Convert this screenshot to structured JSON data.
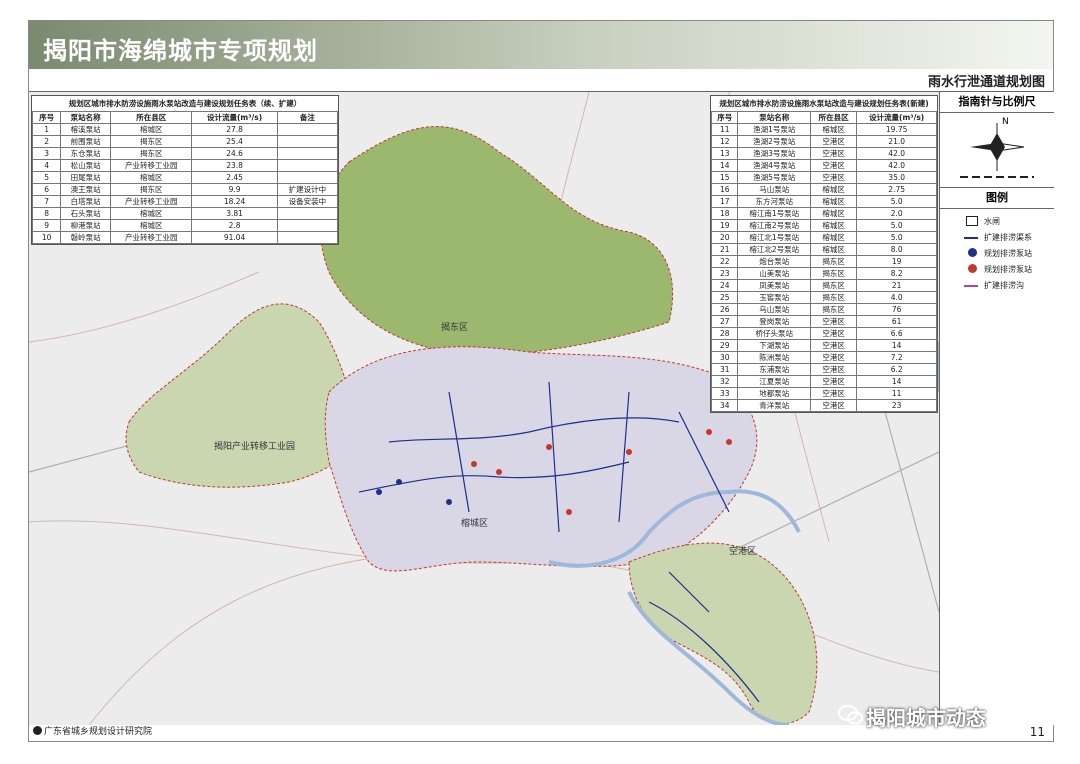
{
  "header": {
    "title": "揭阳市海绵城市专项规划",
    "subtitle": "雨水行泄通道规划图"
  },
  "sidebar": {
    "compass_title": "指南针与比例尺",
    "compass_north": "N",
    "legend_title": "图例",
    "legend": [
      {
        "label": "水闸",
        "icon": "sluice-icon"
      },
      {
        "label": "扩建排涝渠系",
        "icon": "drainage-line-icon"
      },
      {
        "label": "规划排涝泵站",
        "icon": "planned-pump-icon"
      },
      {
        "label": "规划排涝泵站",
        "icon": "planned-pump-red-icon"
      },
      {
        "label": "扩建排涝沟",
        "icon": "ditch-line-icon"
      }
    ]
  },
  "table_left": {
    "caption": "规划区城市排水防涝设施雨水泵站改造与建设规划任务表（续、扩建）",
    "headers": [
      "序号",
      "泵站名称",
      "所在县区",
      "设计流量(m³/s)",
      "备注"
    ],
    "rows": [
      [
        "1",
        "榕溪泵站",
        "榕城区",
        "27.8",
        ""
      ],
      [
        "2",
        "前围泵站",
        "揭东区",
        "25.4",
        ""
      ],
      [
        "3",
        "东仓泵站",
        "揭东区",
        "24.6",
        ""
      ],
      [
        "4",
        "松山泵站",
        "产业转移工业园",
        "23.8",
        ""
      ],
      [
        "5",
        "田尾泵站",
        "榕城区",
        "2.45",
        ""
      ],
      [
        "6",
        "澳王泵站",
        "揭东区",
        "9.9",
        "扩建设计中"
      ],
      [
        "7",
        "白塔泵站",
        "产业转移工业园",
        "18.24",
        "设备安装中"
      ],
      [
        "8",
        "石头泵站",
        "榕城区",
        "3.81",
        ""
      ],
      [
        "9",
        "柳港泵站",
        "榕城区",
        "2.8",
        ""
      ],
      [
        "10",
        "磐岭泵站",
        "产业转移工业园",
        "91.04",
        ""
      ]
    ]
  },
  "table_right": {
    "caption": "规划区城市排水防涝设施雨水泵站改造与建设规划任务表(新建)",
    "headers": [
      "序号",
      "泵站名称",
      "所在县区",
      "设计流量(m³/s)"
    ],
    "rows": [
      [
        "11",
        "渔湖1号泵站",
        "榕城区",
        "19.75"
      ],
      [
        "12",
        "渔湖2号泵站",
        "空港区",
        "21.0"
      ],
      [
        "13",
        "渔湖3号泵站",
        "空港区",
        "42.0"
      ],
      [
        "14",
        "渔湖4号泵站",
        "空港区",
        "42.0"
      ],
      [
        "15",
        "渔湖5号泵站",
        "空港区",
        "35.0"
      ],
      [
        "16",
        "马山泵站",
        "榕城区",
        "2.75"
      ],
      [
        "17",
        "东方河泵站",
        "榕城区",
        "5.0"
      ],
      [
        "18",
        "榕江南1号泵站",
        "榕城区",
        "2.0"
      ],
      [
        "19",
        "榕江南2号泵站",
        "榕城区",
        "5.0"
      ],
      [
        "20",
        "榕江北1号泵站",
        "榕城区",
        "5.0"
      ],
      [
        "21",
        "榕江北2号泵站",
        "榕城区",
        "8.0"
      ],
      [
        "22",
        "炮台泵站",
        "揭东区",
        "19"
      ],
      [
        "23",
        "山美泵站",
        "揭东区",
        "8.2"
      ],
      [
        "24",
        "凤美泵站",
        "揭东区",
        "21"
      ],
      [
        "25",
        "玉窖泵站",
        "揭东区",
        "4.0"
      ],
      [
        "26",
        "乌山泵站",
        "揭东区",
        "76"
      ],
      [
        "27",
        "登岗泵站",
        "空港区",
        "61"
      ],
      [
        "28",
        "桥仔头泵站",
        "空港区",
        "6.6"
      ],
      [
        "29",
        "下湖泵站",
        "空港区",
        "14"
      ],
      [
        "30",
        "陈洲泵站",
        "空港区",
        "7.2"
      ],
      [
        "31",
        "东浦泵站",
        "空港区",
        "6.2"
      ],
      [
        "32",
        "江夏泵站",
        "空港区",
        "14"
      ],
      [
        "33",
        "地都泵站",
        "空港区",
        "11"
      ],
      [
        "34",
        "青洋泵站",
        "空港区",
        "23"
      ]
    ]
  },
  "map_labels": {
    "jiedong": "揭东区",
    "industrial_park": "揭阳产业转移工业园",
    "rongcheng": "榕城区",
    "konggang": "空港区"
  },
  "footer": {
    "institute": "广东省城乡规划设计研究院",
    "page": "11",
    "watermark": "揭阳城市动态"
  },
  "colors": {
    "title_bar": "#7a8a6f",
    "boundary": "#c0392b",
    "hills": "#9cb86f",
    "urban": "#d9d7e6",
    "river": "#9fb7d8",
    "drainage": "#1f2f8a"
  }
}
